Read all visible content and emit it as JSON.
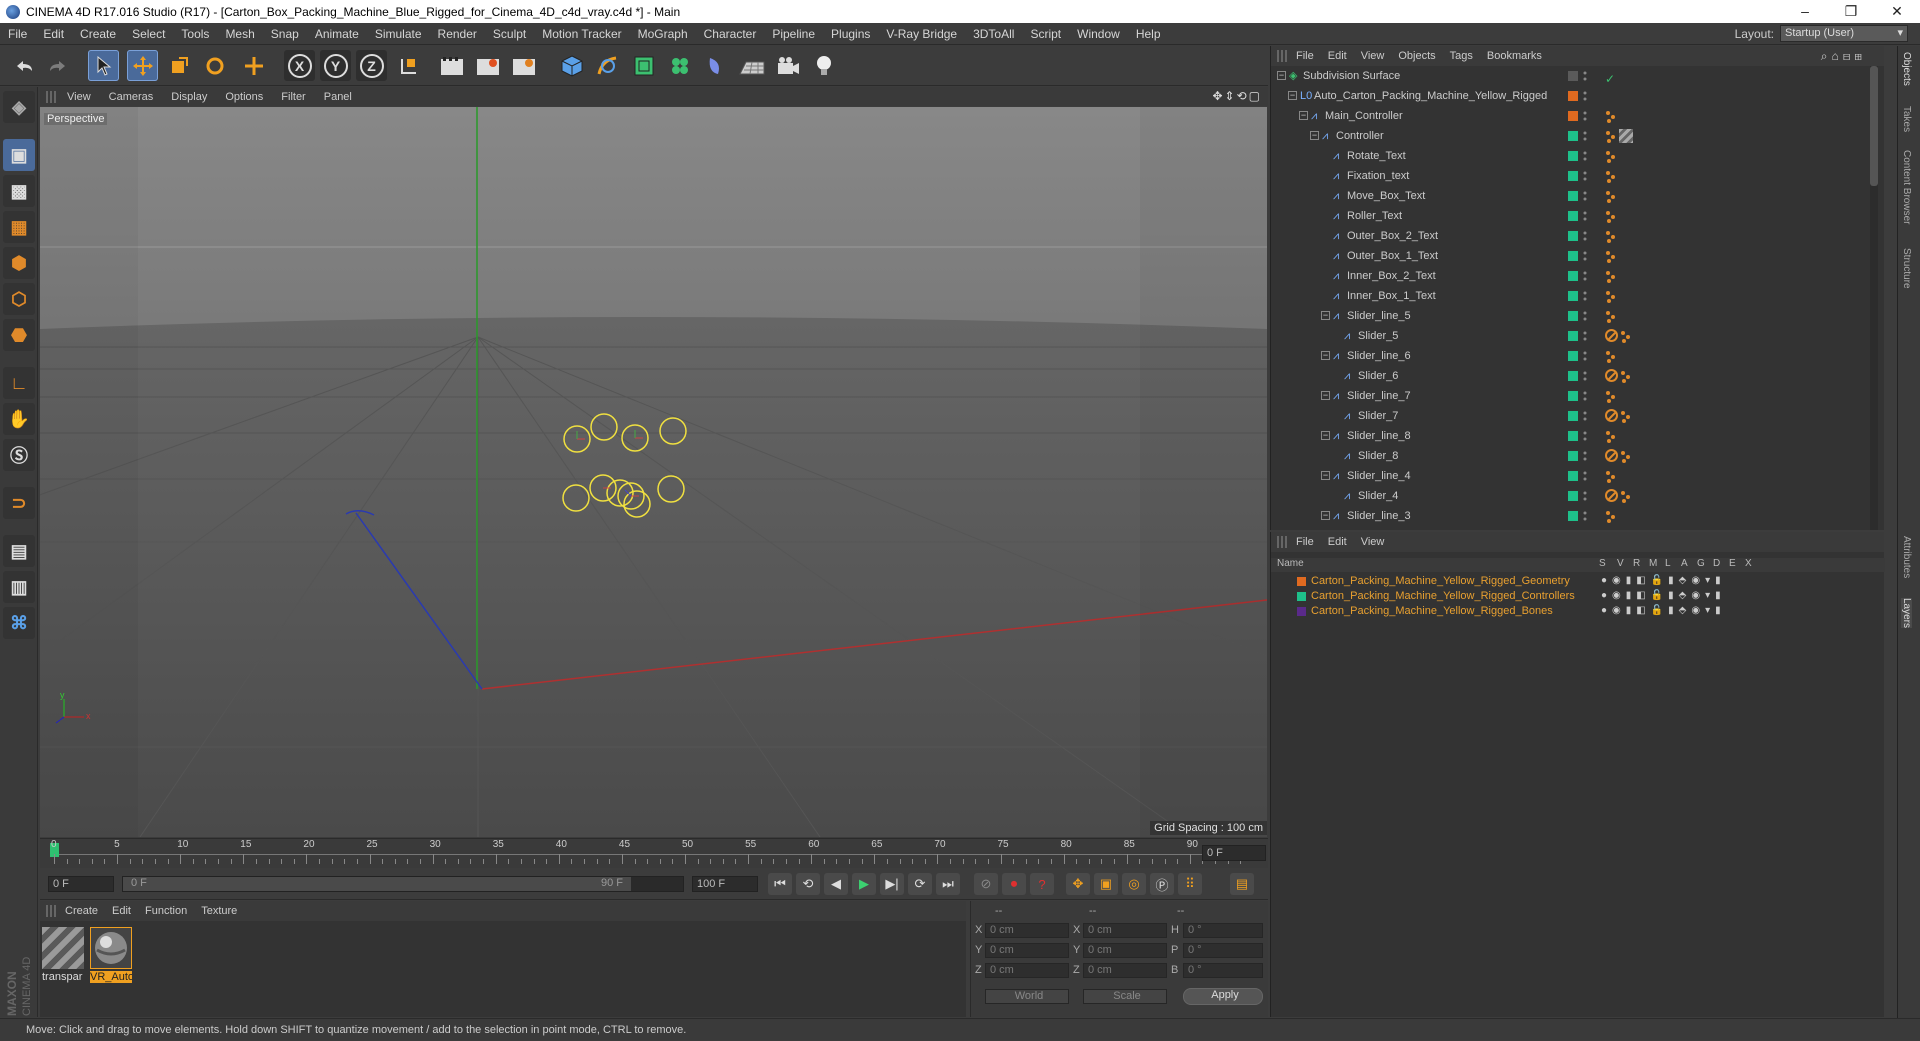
{
  "window": {
    "title": "CINEMA 4D R17.016 Studio (R17) - [Carton_Box_Packing_Machine_Blue_Rigged_for_Cinema_4D_c4d_vray.c4d *] - Main",
    "controls": [
      "–",
      "❐",
      "✕"
    ]
  },
  "menubar": {
    "items": [
      "File",
      "Edit",
      "Create",
      "Select",
      "Tools",
      "Mesh",
      "Snap",
      "Animate",
      "Simulate",
      "Render",
      "Sculpt",
      "Motion Tracker",
      "MoGraph",
      "Character",
      "Pipeline",
      "Plugins",
      "V-Ray Bridge",
      "3DToAll",
      "Script",
      "Window",
      "Help"
    ],
    "layout_label": "Layout:",
    "layout_value": "Startup (User)"
  },
  "toolbar": {
    "axis_x": "X",
    "axis_y": "Y",
    "axis_z": "Z"
  },
  "viewport": {
    "menu": [
      "View",
      "Cameras",
      "Display",
      "Options",
      "Filter",
      "Panel"
    ],
    "label": "Perspective",
    "grid_spacing": "Grid Spacing : 100 cm",
    "axis_y_label": "y",
    "axis_x_label": "x"
  },
  "timeline": {
    "ticks": [
      "0",
      "5",
      "10",
      "15",
      "20",
      "25",
      "30",
      "35",
      "40",
      "45",
      "50",
      "55",
      "60",
      "65",
      "70",
      "75",
      "80",
      "85",
      "90"
    ],
    "current_frame": "0 F"
  },
  "playback": {
    "start": "0 F",
    "range_start": "0 F",
    "range_end": "90 F",
    "end": "100 F"
  },
  "material_manager": {
    "menu": [
      "Create",
      "Edit",
      "Function",
      "Texture"
    ],
    "materials": [
      {
        "label": "transpar"
      },
      {
        "label": "VR_Auto"
      }
    ],
    "logo_text": "MAXON CINEMA 4D"
  },
  "coordinates": {
    "headers": [
      "--",
      "--",
      "--"
    ],
    "rows": [
      {
        "axis": "X",
        "pos": "0 cm",
        "saxis": "X",
        "size": "0 cm",
        "raxis": "H",
        "rot": "0 °"
      },
      {
        "axis": "Y",
        "pos": "0 cm",
        "saxis": "Y",
        "size": "0 cm",
        "raxis": "P",
        "rot": "0 °"
      },
      {
        "axis": "Z",
        "pos": "0 cm",
        "saxis": "Z",
        "size": "0 cm",
        "raxis": "B",
        "rot": "0 °"
      }
    ],
    "mode_world": "World",
    "mode_scale": "Scale",
    "apply": "Apply"
  },
  "object_manager": {
    "menu": [
      "File",
      "Edit",
      "View",
      "Objects",
      "Tags",
      "Bookmarks"
    ],
    "objects": [
      {
        "name": "Subdivision Surface",
        "color": "#5a5a5a",
        "tags": "check"
      },
      {
        "name": "Auto_Carton_Packing_Machine_Yellow_Rigged",
        "color": "#e06a20",
        "tags": ""
      },
      {
        "name": "Main_Controller",
        "color": "#e06a20",
        "tags": "dots"
      },
      {
        "name": "Controller",
        "color": "#1ec08a",
        "tags": "dots-tex"
      },
      {
        "name": "Rotate_Text",
        "color": "#1ec08a",
        "tags": "dots"
      },
      {
        "name": "Fixation_text",
        "color": "#1ec08a",
        "tags": "dots"
      },
      {
        "name": "Move_Box_Text",
        "color": "#1ec08a",
        "tags": "dots"
      },
      {
        "name": "Roller_Text",
        "color": "#1ec08a",
        "tags": "dots"
      },
      {
        "name": "Outer_Box_2_Text",
        "color": "#1ec08a",
        "tags": "dots"
      },
      {
        "name": "Outer_Box_1_Text",
        "color": "#1ec08a",
        "tags": "dots"
      },
      {
        "name": "Inner_Box_2_Text",
        "color": "#1ec08a",
        "tags": "dots"
      },
      {
        "name": "Inner_Box_1_Text",
        "color": "#1ec08a",
        "tags": "dots"
      },
      {
        "name": "Slider_line_5",
        "color": "#1ec08a",
        "tags": "dots"
      },
      {
        "name": "Slider_5",
        "color": "#1ec08a",
        "tags": "no-dots"
      },
      {
        "name": "Slider_line_6",
        "color": "#1ec08a",
        "tags": "dots"
      },
      {
        "name": "Slider_6",
        "color": "#1ec08a",
        "tags": "no-dots"
      },
      {
        "name": "Slider_line_7",
        "color": "#1ec08a",
        "tags": "dots"
      },
      {
        "name": "Slider_7",
        "color": "#1ec08a",
        "tags": "no-dots"
      },
      {
        "name": "Slider_line_8",
        "color": "#1ec08a",
        "tags": "dots"
      },
      {
        "name": "Slider_8",
        "color": "#1ec08a",
        "tags": "no-dots"
      },
      {
        "name": "Slider_line_4",
        "color": "#1ec08a",
        "tags": "dots"
      },
      {
        "name": "Slider_4",
        "color": "#1ec08a",
        "tags": "no-dots"
      },
      {
        "name": "Slider_line_3",
        "color": "#1ec08a",
        "tags": "dots"
      }
    ]
  },
  "layer_manager": {
    "menu": [
      "File",
      "Edit",
      "View"
    ],
    "columns": [
      "Name",
      "S",
      "V",
      "R",
      "M",
      "L",
      "A",
      "G",
      "D",
      "E",
      "X"
    ],
    "layers": [
      {
        "name": "Carton_Packing_Machine_Yellow_Rigged_Geometry",
        "color": "#e06a20"
      },
      {
        "name": "Carton_Packing_Machine_Yellow_Rigged_Controllers",
        "color": "#1ec08a"
      },
      {
        "name": "Carton_Packing_Machine_Yellow_Rigged_Bones",
        "color": "#5a2a8a"
      }
    ]
  },
  "side_tabs": [
    "Objects",
    "Takes",
    "Content Browser",
    "Structure",
    "Attributes",
    "Layers"
  ],
  "statusbar": {
    "text": "Move: Click and drag to move elements. Hold down SHIFT to quantize movement / add to the selection in point mode, CTRL to remove."
  }
}
